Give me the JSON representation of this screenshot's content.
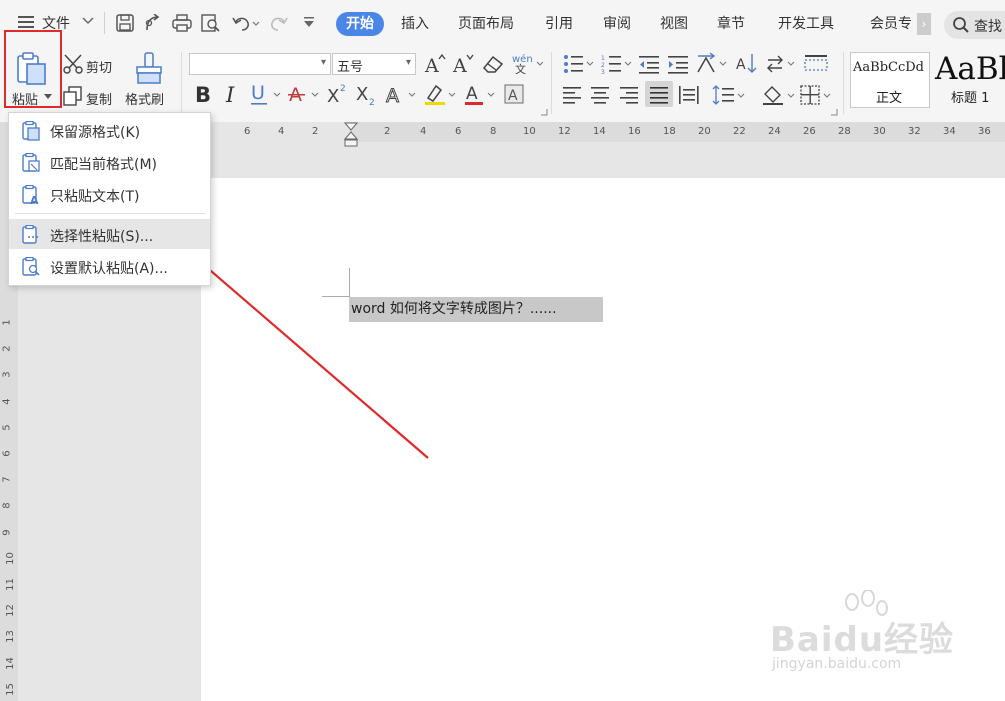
{
  "menubar": {
    "file_label": "文件",
    "tabs": [
      "开始",
      "插入",
      "页面布局",
      "引用",
      "审阅",
      "视图",
      "章节",
      "开发工具",
      "会员专"
    ],
    "search_label": "查找"
  },
  "ribbon": {
    "paste_label": "粘贴",
    "cut_label": "剪切",
    "copy_label": "复制",
    "format_painter_label": "格式刷",
    "font_name_value": "",
    "font_size_value": "五号",
    "style_normal_preview": "AaBbCcDd",
    "style_normal_label": "正文",
    "style_heading_preview": "AaBb",
    "style_heading_label": "标题 1"
  },
  "ruler": {
    "h_numbers": [
      "6",
      "4",
      "2",
      "2",
      "4",
      "6",
      "8",
      "10",
      "12",
      "14",
      "16",
      "18",
      "20",
      "22",
      "24",
      "26",
      "28",
      "30",
      "32",
      "34",
      "36"
    ],
    "v_numbers": [
      "1",
      "2",
      "3",
      "4",
      "5",
      "6",
      "7",
      "8",
      "9",
      "10",
      "11",
      "12",
      "13",
      "14",
      "15"
    ]
  },
  "paste_menu": {
    "items": [
      {
        "label": "保留源格式(K)"
      },
      {
        "label": "匹配当前格式(M)"
      },
      {
        "label": "只粘贴文本(T)"
      },
      {
        "label": "选择性粘贴(S)..."
      },
      {
        "label": "设置默认粘贴(A)..."
      }
    ]
  },
  "document": {
    "text": "word 如何将文字转成图片？......"
  },
  "watermark": {
    "brand": "Baidu经验",
    "url": "jingyan.baidu.com"
  },
  "colors": {
    "accent": "#4a85e8",
    "annotation_red": "#e0292b"
  }
}
